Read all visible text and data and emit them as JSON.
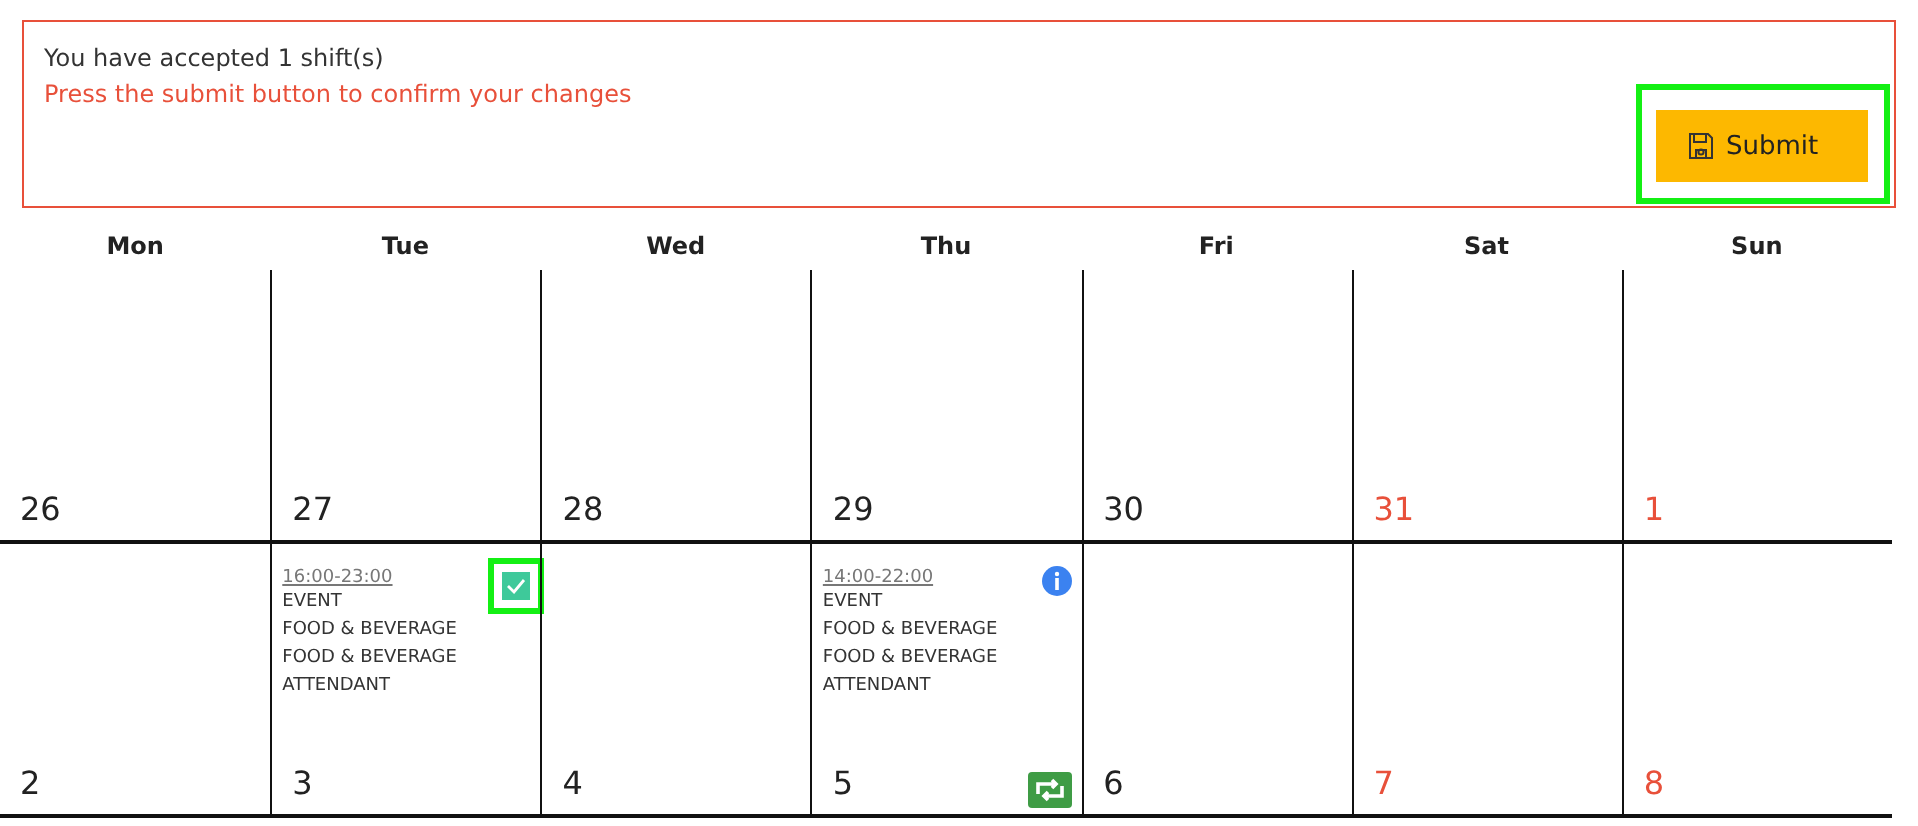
{
  "notice": {
    "message": "You have accepted 1 shift(s)",
    "prompt": "Press the submit button to confirm your changes",
    "submit": {
      "label": "Submit",
      "highlighted": true
    }
  },
  "weekdays": [
    "Mon",
    "Tue",
    "Wed",
    "Thu",
    "Fri",
    "Sat",
    "Sun"
  ],
  "weeks": [
    {
      "days": [
        {
          "date": "26",
          "weekend": false
        },
        {
          "date": "27",
          "weekend": false
        },
        {
          "date": "28",
          "weekend": false
        },
        {
          "date": "29",
          "weekend": false
        },
        {
          "date": "30",
          "weekend": false
        },
        {
          "date": "31",
          "weekend": true
        },
        {
          "date": "1",
          "weekend": true
        }
      ]
    },
    {
      "days": [
        {
          "date": "2",
          "weekend": false
        },
        {
          "date": "3",
          "weekend": false,
          "shift": {
            "time": "16:00-23:00",
            "lines": [
              "EVENT",
              "FOOD & BEVERAGE",
              "FOOD & BEVERAGE",
              "ATTENDANT"
            ],
            "kind": "checkbox",
            "checked": true,
            "highlighted": true
          }
        },
        {
          "date": "4",
          "weekend": false
        },
        {
          "date": "5",
          "weekend": false,
          "shift": {
            "time": "14:00-22:00",
            "lines": [
              "EVENT",
              "FOOD & BEVERAGE",
              "FOOD & BEVERAGE",
              "ATTENDANT"
            ],
            "kind": "info",
            "swap": true
          }
        },
        {
          "date": "6",
          "weekend": false
        },
        {
          "date": "7",
          "weekend": true
        },
        {
          "date": "8",
          "weekend": true
        }
      ]
    }
  ]
}
